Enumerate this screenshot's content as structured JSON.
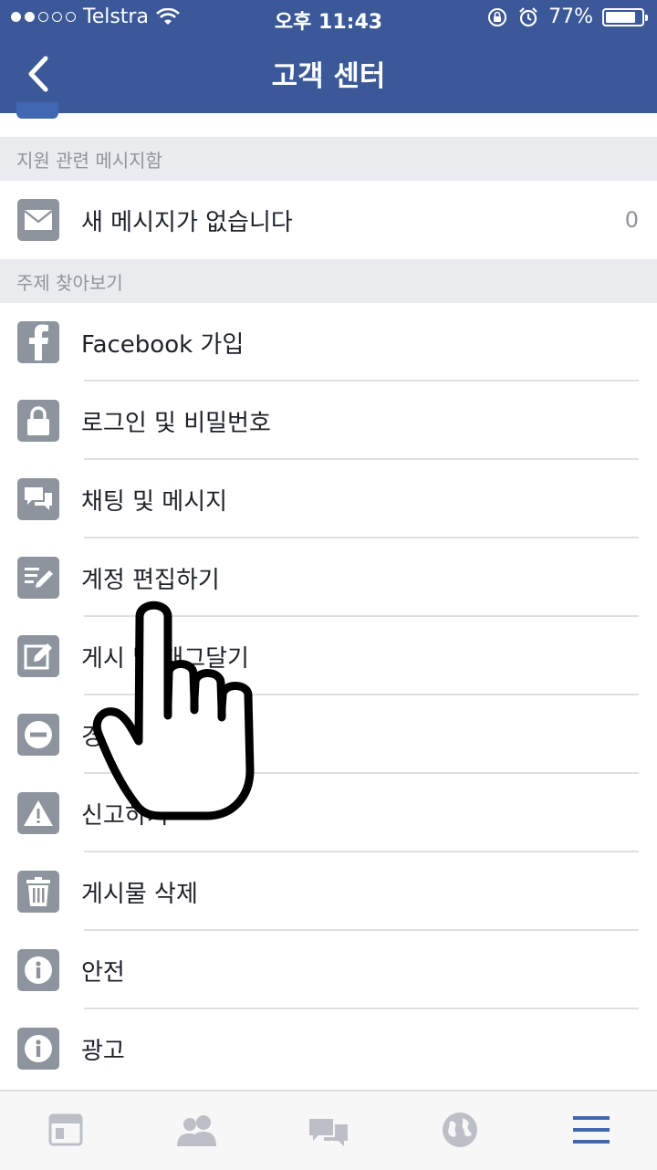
{
  "status_bar": {
    "carrier": "Telstra",
    "time": "오후 11:43",
    "battery_percent": "77%",
    "battery_level": 0.77,
    "signal_bars_filled": 2,
    "signal_bars_total": 5
  },
  "header": {
    "title": "고객 센터",
    "back_icon": "chevron-left-icon"
  },
  "sections": {
    "support_inbox": {
      "title": "지원 관련 메시지함",
      "message_label": "새 메시지가 없습니다",
      "message_count": "0"
    },
    "browse_topics": {
      "title": "주제 찾아보기",
      "items": [
        {
          "label": "Facebook 가입",
          "icon": "facebook-icon"
        },
        {
          "label": "로그인 및 비밀번호",
          "icon": "lock-icon"
        },
        {
          "label": "채팅 및 메시지",
          "icon": "chat-bubbles-icon"
        },
        {
          "label": "계정 편집하기",
          "icon": "edit-list-icon"
        },
        {
          "label": "게시 및 태그달기",
          "icon": "compose-icon"
        },
        {
          "label": "경고와 차단",
          "icon": "block-icon"
        },
        {
          "label": "신고하기",
          "icon": "warning-icon"
        },
        {
          "label": "게시물 삭제",
          "icon": "trash-icon"
        },
        {
          "label": "안전",
          "icon": "info-icon"
        },
        {
          "label": "광고",
          "icon": "info-icon"
        }
      ]
    }
  },
  "tabbar": {
    "tabs": [
      {
        "icon": "news-feed-icon",
        "active": false
      },
      {
        "icon": "friends-icon",
        "active": false
      },
      {
        "icon": "messages-icon",
        "active": false
      },
      {
        "icon": "globe-notifications-icon",
        "active": false
      },
      {
        "icon": "menu-icon",
        "active": true
      }
    ]
  },
  "colors": {
    "brand": "#3b5998",
    "section_bg": "#e9ebee",
    "icon_gray": "#8d949e",
    "active_tab": "#4267b2",
    "inactive_tab": "#bcc0c6"
  }
}
